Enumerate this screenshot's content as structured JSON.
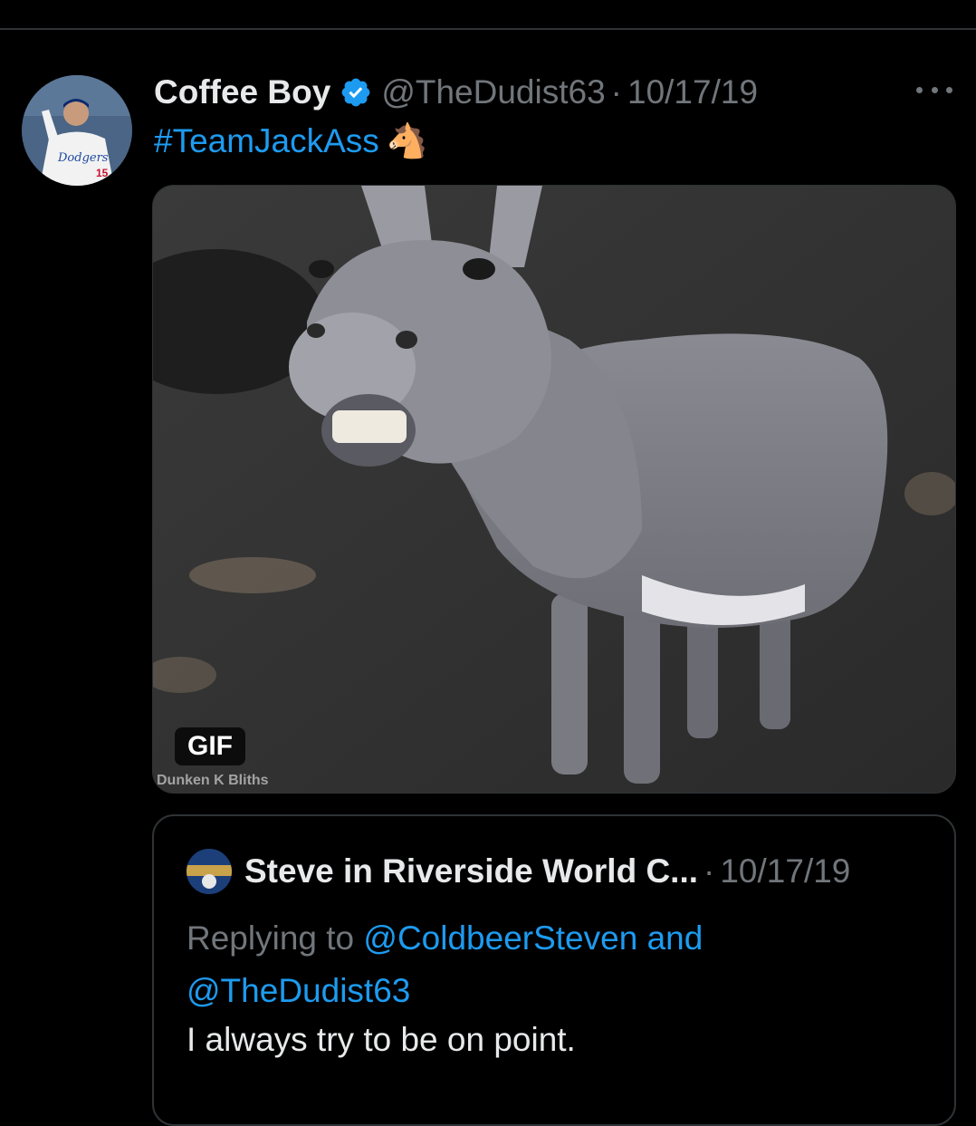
{
  "tweet": {
    "display_name": "Coffee Boy",
    "handle": "@TheDudist63",
    "separator": "·",
    "date": "10/17/19",
    "hashtag": "#TeamJackAss",
    "emoji": "🐴",
    "media": {
      "badge": "GIF",
      "watermark": "Dunken K Bliths"
    },
    "avatar_text": "Dodgers",
    "avatar_number": "15"
  },
  "quoted": {
    "display_name": "Steve in Riverside World C...",
    "separator": "·",
    "date": "10/17/19",
    "replying_prefix": "Replying to ",
    "mention_1": "@ColdbeerSteven",
    "and_text": " and",
    "mention_2": "@TheDudist63",
    "text": "I always try to be on point."
  },
  "colors": {
    "background": "#000000",
    "primary_text": "#e7e9ea",
    "secondary_text": "#71767b",
    "accent": "#1d9bf0",
    "border": "#2f3336"
  }
}
